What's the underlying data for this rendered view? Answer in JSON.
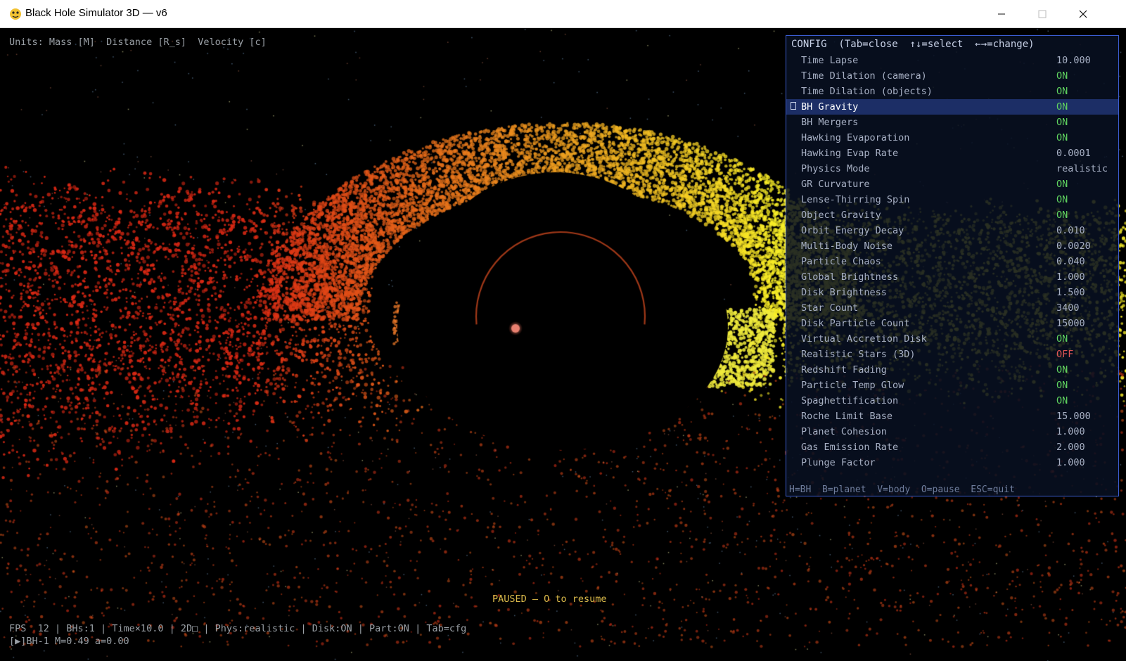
{
  "window": {
    "title": "Black Hole Simulator 3D  —  v6",
    "controls": [
      "minimize-icon",
      "maximize-icon",
      "close-icon"
    ]
  },
  "hud": {
    "units": "Units: Mass [M]  Distance [R_s]  Velocity [c]",
    "paused": "PAUSED — O to resume",
    "status": "FPS  12 | BHs:1 | Time×10.0 | 2D□ | Phys:realistic | Disk:ON | Part:ON | Tab=cfg",
    "bh_info": "[▶]BH-1 M=0.49 a=0.00"
  },
  "config": {
    "header": "CONFIG  (Tab=close  ↑↓=select  ←→=change)",
    "selected_index": 3,
    "items": [
      {
        "label": "Time Lapse",
        "value": "10.000"
      },
      {
        "label": "Time Dilation (camera)",
        "value": "ON"
      },
      {
        "label": "Time Dilation (objects)",
        "value": "ON"
      },
      {
        "label": "BH Gravity",
        "value": "ON"
      },
      {
        "label": "BH Mergers",
        "value": "ON"
      },
      {
        "label": "Hawking Evaporation",
        "value": "ON"
      },
      {
        "label": "Hawking Evap Rate",
        "value": "0.0001"
      },
      {
        "label": "Physics Mode",
        "value": "realistic"
      },
      {
        "label": "GR Curvature",
        "value": "ON"
      },
      {
        "label": "Lense-Thirring Spin",
        "value": "ON"
      },
      {
        "label": "Object Gravity",
        "value": "ON"
      },
      {
        "label": "Orbit Energy Decay",
        "value": "0.010"
      },
      {
        "label": "Multi-Body Noise",
        "value": "0.0020"
      },
      {
        "label": "Particle Chaos",
        "value": "0.040"
      },
      {
        "label": "Global Brightness",
        "value": "1.000"
      },
      {
        "label": "Disk Brightness",
        "value": "1.500"
      },
      {
        "label": "Star Count",
        "value": "3400"
      },
      {
        "label": "Disk Particle Count",
        "value": "15000"
      },
      {
        "label": "Virtual Accretion Disk",
        "value": "ON"
      },
      {
        "label": "Realistic Stars (3D)",
        "value": "OFF"
      },
      {
        "label": "Redshift Fading",
        "value": "ON"
      },
      {
        "label": "Particle Temp Glow",
        "value": "ON"
      },
      {
        "label": "Spaghettification",
        "value": "ON"
      },
      {
        "label": "Roche Limit Base",
        "value": "15.000"
      },
      {
        "label": "Planet Cohesion",
        "value": "1.000"
      },
      {
        "label": "Gas Emission Rate",
        "value": "2.000"
      },
      {
        "label": "Plunge Factor",
        "value": "1.000"
      }
    ],
    "footer": "H=BH  B=planet  V=body  O=pause  ESC=quit"
  },
  "colors": {
    "on": "#5fd35f",
    "off": "#e05555",
    "panel_border": "#3b5cd0",
    "selected_row": "#1c2e66",
    "paused_text": "#d9b94a",
    "disk_hot": "#e8e830",
    "disk_mid": "#f08c1e",
    "disk_cool": "#d62a14"
  }
}
